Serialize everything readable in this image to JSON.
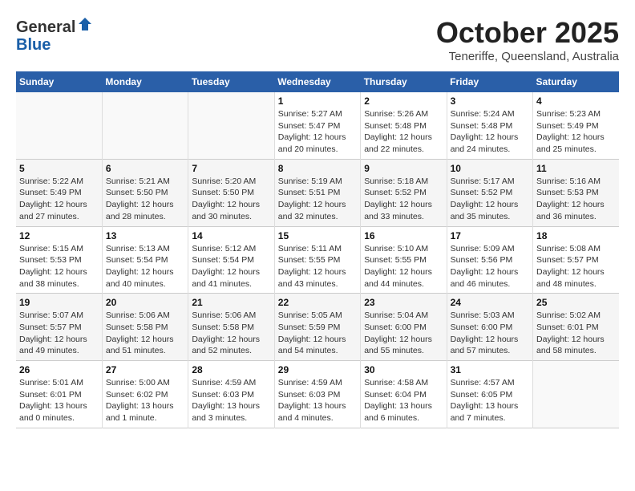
{
  "header": {
    "logo_line1": "General",
    "logo_line2": "Blue",
    "month": "October 2025",
    "location": "Teneriffe, Queensland, Australia"
  },
  "weekdays": [
    "Sunday",
    "Monday",
    "Tuesday",
    "Wednesday",
    "Thursday",
    "Friday",
    "Saturday"
  ],
  "rows": [
    [
      {
        "day": "",
        "info": ""
      },
      {
        "day": "",
        "info": ""
      },
      {
        "day": "",
        "info": ""
      },
      {
        "day": "1",
        "info": "Sunrise: 5:27 AM\nSunset: 5:47 PM\nDaylight: 12 hours and 20 minutes."
      },
      {
        "day": "2",
        "info": "Sunrise: 5:26 AM\nSunset: 5:48 PM\nDaylight: 12 hours and 22 minutes."
      },
      {
        "day": "3",
        "info": "Sunrise: 5:24 AM\nSunset: 5:48 PM\nDaylight: 12 hours and 24 minutes."
      },
      {
        "day": "4",
        "info": "Sunrise: 5:23 AM\nSunset: 5:49 PM\nDaylight: 12 hours and 25 minutes."
      }
    ],
    [
      {
        "day": "5",
        "info": "Sunrise: 5:22 AM\nSunset: 5:49 PM\nDaylight: 12 hours and 27 minutes."
      },
      {
        "day": "6",
        "info": "Sunrise: 5:21 AM\nSunset: 5:50 PM\nDaylight: 12 hours and 28 minutes."
      },
      {
        "day": "7",
        "info": "Sunrise: 5:20 AM\nSunset: 5:50 PM\nDaylight: 12 hours and 30 minutes."
      },
      {
        "day": "8",
        "info": "Sunrise: 5:19 AM\nSunset: 5:51 PM\nDaylight: 12 hours and 32 minutes."
      },
      {
        "day": "9",
        "info": "Sunrise: 5:18 AM\nSunset: 5:52 PM\nDaylight: 12 hours and 33 minutes."
      },
      {
        "day": "10",
        "info": "Sunrise: 5:17 AM\nSunset: 5:52 PM\nDaylight: 12 hours and 35 minutes."
      },
      {
        "day": "11",
        "info": "Sunrise: 5:16 AM\nSunset: 5:53 PM\nDaylight: 12 hours and 36 minutes."
      }
    ],
    [
      {
        "day": "12",
        "info": "Sunrise: 5:15 AM\nSunset: 5:53 PM\nDaylight: 12 hours and 38 minutes."
      },
      {
        "day": "13",
        "info": "Sunrise: 5:13 AM\nSunset: 5:54 PM\nDaylight: 12 hours and 40 minutes."
      },
      {
        "day": "14",
        "info": "Sunrise: 5:12 AM\nSunset: 5:54 PM\nDaylight: 12 hours and 41 minutes."
      },
      {
        "day": "15",
        "info": "Sunrise: 5:11 AM\nSunset: 5:55 PM\nDaylight: 12 hours and 43 minutes."
      },
      {
        "day": "16",
        "info": "Sunrise: 5:10 AM\nSunset: 5:55 PM\nDaylight: 12 hours and 44 minutes."
      },
      {
        "day": "17",
        "info": "Sunrise: 5:09 AM\nSunset: 5:56 PM\nDaylight: 12 hours and 46 minutes."
      },
      {
        "day": "18",
        "info": "Sunrise: 5:08 AM\nSunset: 5:57 PM\nDaylight: 12 hours and 48 minutes."
      }
    ],
    [
      {
        "day": "19",
        "info": "Sunrise: 5:07 AM\nSunset: 5:57 PM\nDaylight: 12 hours and 49 minutes."
      },
      {
        "day": "20",
        "info": "Sunrise: 5:06 AM\nSunset: 5:58 PM\nDaylight: 12 hours and 51 minutes."
      },
      {
        "day": "21",
        "info": "Sunrise: 5:06 AM\nSunset: 5:58 PM\nDaylight: 12 hours and 52 minutes."
      },
      {
        "day": "22",
        "info": "Sunrise: 5:05 AM\nSunset: 5:59 PM\nDaylight: 12 hours and 54 minutes."
      },
      {
        "day": "23",
        "info": "Sunrise: 5:04 AM\nSunset: 6:00 PM\nDaylight: 12 hours and 55 minutes."
      },
      {
        "day": "24",
        "info": "Sunrise: 5:03 AM\nSunset: 6:00 PM\nDaylight: 12 hours and 57 minutes."
      },
      {
        "day": "25",
        "info": "Sunrise: 5:02 AM\nSunset: 6:01 PM\nDaylight: 12 hours and 58 minutes."
      }
    ],
    [
      {
        "day": "26",
        "info": "Sunrise: 5:01 AM\nSunset: 6:01 PM\nDaylight: 13 hours and 0 minutes."
      },
      {
        "day": "27",
        "info": "Sunrise: 5:00 AM\nSunset: 6:02 PM\nDaylight: 13 hours and 1 minute."
      },
      {
        "day": "28",
        "info": "Sunrise: 4:59 AM\nSunset: 6:03 PM\nDaylight: 13 hours and 3 minutes."
      },
      {
        "day": "29",
        "info": "Sunrise: 4:59 AM\nSunset: 6:03 PM\nDaylight: 13 hours and 4 minutes."
      },
      {
        "day": "30",
        "info": "Sunrise: 4:58 AM\nSunset: 6:04 PM\nDaylight: 13 hours and 6 minutes."
      },
      {
        "day": "31",
        "info": "Sunrise: 4:57 AM\nSunset: 6:05 PM\nDaylight: 13 hours and 7 minutes."
      },
      {
        "day": "",
        "info": ""
      }
    ]
  ]
}
